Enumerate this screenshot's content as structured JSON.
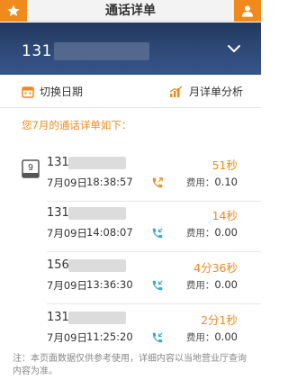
{
  "topbar": {
    "title": "通话详单",
    "left_icon": "star-icon",
    "right_icon": "user-icon",
    "accent": "#f08a1d"
  },
  "header": {
    "number_prefix": "131",
    "chevron_icon": "chevron-down-icon"
  },
  "actions": {
    "switch_date_label": "切换日期",
    "monthly_analysis_label": "月详单分析"
  },
  "section": {
    "title": "您7月的通话详单如下："
  },
  "calendar_badge": {
    "day": "9"
  },
  "records": [
    {
      "number_prefix": "131",
      "date": "7月09日",
      "time": "18:38:57",
      "duration": "51秒",
      "fee_label": "费用：",
      "fee": "0.10",
      "call_type": "outgoing",
      "phone_color": "#f08a1d"
    },
    {
      "number_prefix": "131",
      "date": "7月09日",
      "time": "14:08:07",
      "duration": "14秒",
      "fee_label": "费用：",
      "fee": "0.00",
      "call_type": "incoming",
      "phone_color": "#3aa9d9"
    },
    {
      "number_prefix": "156",
      "date": "7月09日",
      "time": "13:36:30",
      "duration": "4分36秒",
      "fee_label": "费用：",
      "fee": "0.00",
      "call_type": "incoming",
      "phone_color": "#3aa9d9"
    },
    {
      "number_prefix": "131",
      "date": "7月09日",
      "time": "11:25:20",
      "duration": "2分1秒",
      "fee_label": "费用：",
      "fee": "0.00",
      "call_type": "incoming",
      "phone_color": "#3aa9d9"
    }
  ],
  "footnote": "注：本页面数据仅供参考使用，详细内容以当地营业厅查询内容为准。"
}
